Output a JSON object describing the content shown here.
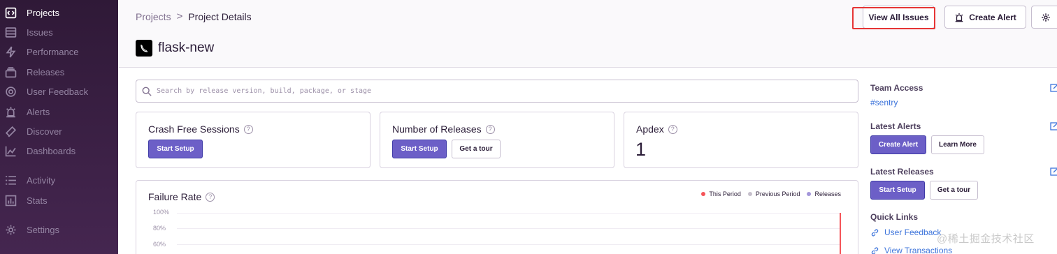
{
  "sidebar": {
    "items": [
      {
        "label": "Projects",
        "icon": "projects-icon",
        "active": true
      },
      {
        "label": "Issues",
        "icon": "issues-icon"
      },
      {
        "label": "Performance",
        "icon": "performance-icon"
      },
      {
        "label": "Releases",
        "icon": "releases-icon"
      },
      {
        "label": "User Feedback",
        "icon": "user-feedback-icon"
      },
      {
        "label": "Alerts",
        "icon": "alerts-icon"
      },
      {
        "label": "Discover",
        "icon": "discover-icon"
      },
      {
        "label": "Dashboards",
        "icon": "dashboards-icon"
      },
      {
        "label": "Activity",
        "icon": "activity-icon"
      },
      {
        "label": "Stats",
        "icon": "stats-icon"
      },
      {
        "label": "Settings",
        "icon": "settings-icon"
      }
    ]
  },
  "breadcrumb": {
    "parent": "Projects",
    "separator": ">",
    "current": "Project Details"
  },
  "project": {
    "name": "flask-new"
  },
  "header_actions": {
    "view_all_issues": "View All Issues",
    "create_alert": "Create Alert"
  },
  "search": {
    "placeholder": "Search by release version, build, package, or stage"
  },
  "cards": {
    "crash_free": {
      "title": "Crash Free Sessions",
      "button": "Start Setup"
    },
    "releases": {
      "title": "Number of Releases",
      "button": "Start Setup",
      "tour": "Get a tour"
    },
    "apdex": {
      "title": "Apdex",
      "value": "1"
    }
  },
  "failure_chart": {
    "title": "Failure Rate",
    "legend": [
      {
        "label": "This Period",
        "color": "#f55459"
      },
      {
        "label": "Previous Period",
        "color": "#c6c0cc"
      },
      {
        "label": "Releases",
        "color": "#a396da"
      }
    ],
    "yticks": [
      "100%",
      "80%",
      "60%"
    ]
  },
  "right": {
    "team_access": {
      "title": "Team Access",
      "team": "#sentry"
    },
    "latest_alerts": {
      "title": "Latest Alerts",
      "create": "Create Alert",
      "learn": "Learn More"
    },
    "latest_releases": {
      "title": "Latest Releases",
      "setup": "Start Setup",
      "tour": "Get a tour"
    },
    "quick_links": {
      "title": "Quick Links",
      "items": [
        "User Feedback",
        "View Transactions"
      ]
    }
  },
  "watermark": "@稀土掘金技术社区",
  "colors": {
    "accent": "#6c5fc7",
    "highlight": "#e63535",
    "link": "#3d74db"
  }
}
